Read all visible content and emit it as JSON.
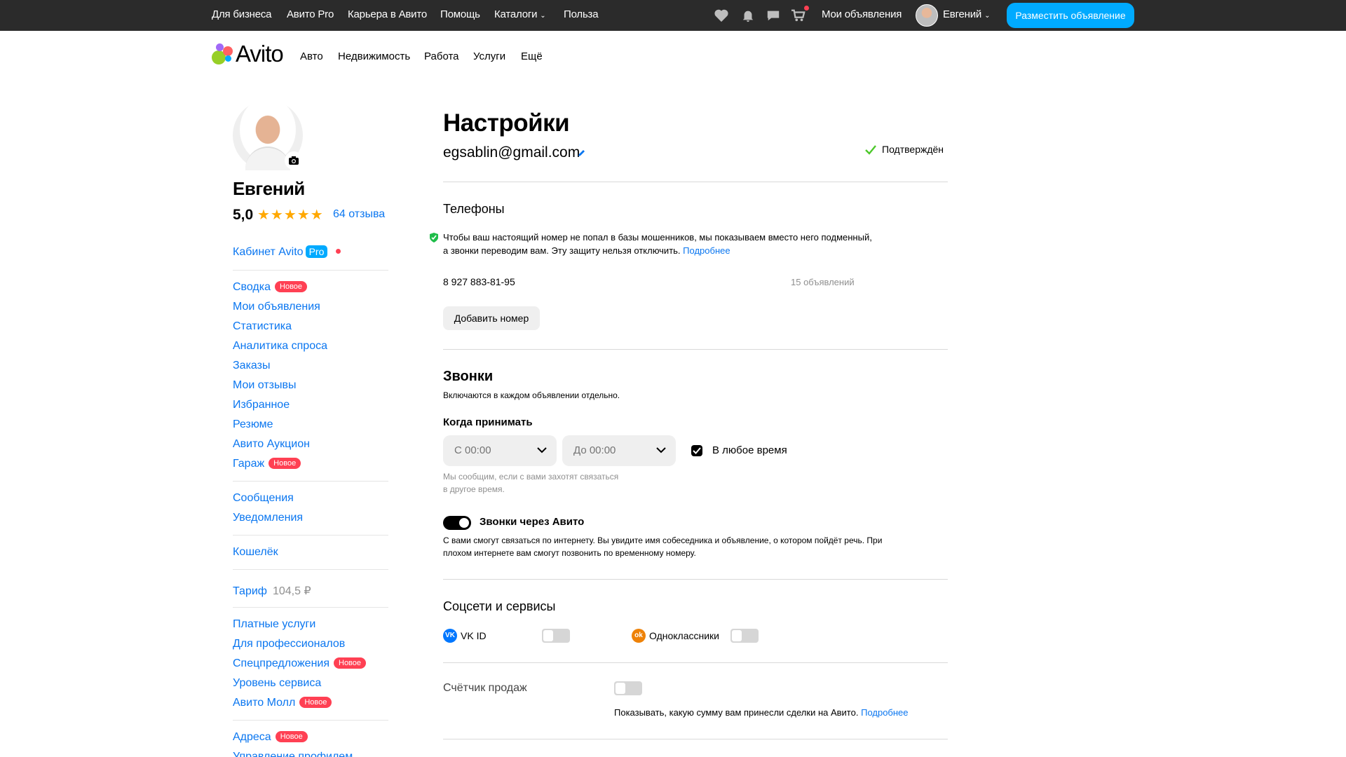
{
  "topbar": {
    "links": [
      "Для бизнеса",
      "Авито Pro",
      "Карьера в Авито",
      "Помощь",
      "Каталоги",
      "Польза"
    ],
    "my_ads": "Мои объявления",
    "user": "Евгений",
    "post_button": "Разместить объявление",
    "icons": [
      "heart-icon",
      "bell-icon",
      "chat-icon",
      "cart-icon"
    ]
  },
  "logo": {
    "word": "Avito",
    "colors": [
      "#97cf26",
      "#a169f7",
      "#ff6163",
      "#0af"
    ]
  },
  "nav": [
    "Авто",
    "Недвижимость",
    "Работа",
    "Услуги",
    "Ещё"
  ],
  "sidebar": {
    "name": "Евгений",
    "rating": "5,0",
    "stars": "★★★★★",
    "reviews": "64 отзыва",
    "cabinet": "Кабинет Avito",
    "cabinet_badge": "Pro",
    "items": [
      {
        "label": "Сводка",
        "badge": "Новое"
      },
      {
        "label": "Мои объявления"
      },
      {
        "label": "Статистика"
      },
      {
        "label": "Аналитика спроса"
      },
      {
        "label": "Заказы"
      },
      {
        "label": "Мои отзывы"
      },
      {
        "label": "Избранное"
      },
      {
        "label": "Резюме"
      },
      {
        "label": "Авито Аукцион"
      },
      {
        "label": "Гараж",
        "badge": "Новое"
      },
      {
        "label": "Сообщения"
      },
      {
        "label": "Уведомления"
      },
      {
        "label": "Кошелёк"
      },
      {
        "label": "Тариф",
        "value": "104,5 ₽"
      },
      {
        "label": "Платные услуги"
      },
      {
        "label": "Для профессионалов"
      },
      {
        "label": "Спецпредложения",
        "badge": "Новое"
      },
      {
        "label": "Уровень сервиса"
      },
      {
        "label": "Авито Молл",
        "badge": "Новое"
      },
      {
        "label": "Адреса",
        "badge": "Новое"
      },
      {
        "label": "Управление профилем"
      }
    ]
  },
  "main": {
    "title": "Настройки",
    "email": "egsablin@gmail.com",
    "verified": "Подтверждён",
    "phones": {
      "heading": "Телефоны",
      "notice_line1": "Чтобы ваш настоящий номер не попал в базы мошенников, мы показываем вместо него подменный,",
      "notice_line2": "а звонки переводим вам. Эту защиту нельзя отключить.",
      "more": "Подробнее",
      "number": "8 927 883-81-95",
      "ads_count": "15 объявлений",
      "add_button": "Добавить номер"
    },
    "calls": {
      "heading": "Звонки",
      "subtitle": "Включаются в каждом объявлении отдельно.",
      "when": "Когда принимать",
      "from": "С 00:00",
      "to": "До 00:00",
      "anytime": "В любое время",
      "hint_line1": "Мы сообщим, если с вами захотят связаться",
      "hint_line2": "в другое время.",
      "via_avito": "Звонки через Авито",
      "via_line1": "С вами смогут связаться по интернету. Вы увидите имя собеседника и объявление, о котором пойдёт речь. При",
      "via_line2": "плохом интернете вам смогут позвонить по временному номеру."
    },
    "social": {
      "heading": "Соцсети и сервисы",
      "vk": "VK ID",
      "ok": "Одноклассники"
    },
    "sales": {
      "label": "Счётчик продаж",
      "desc": "Показывать, какую сумму вам принесли сделки на Авито.",
      "more": "Подробнее"
    }
  },
  "colors": {
    "accent": "#0a76f0",
    "brand_button": "#00aaff",
    "badge": "#ff4053",
    "star": "#ffa800",
    "topbar": "#2b2b2b"
  }
}
